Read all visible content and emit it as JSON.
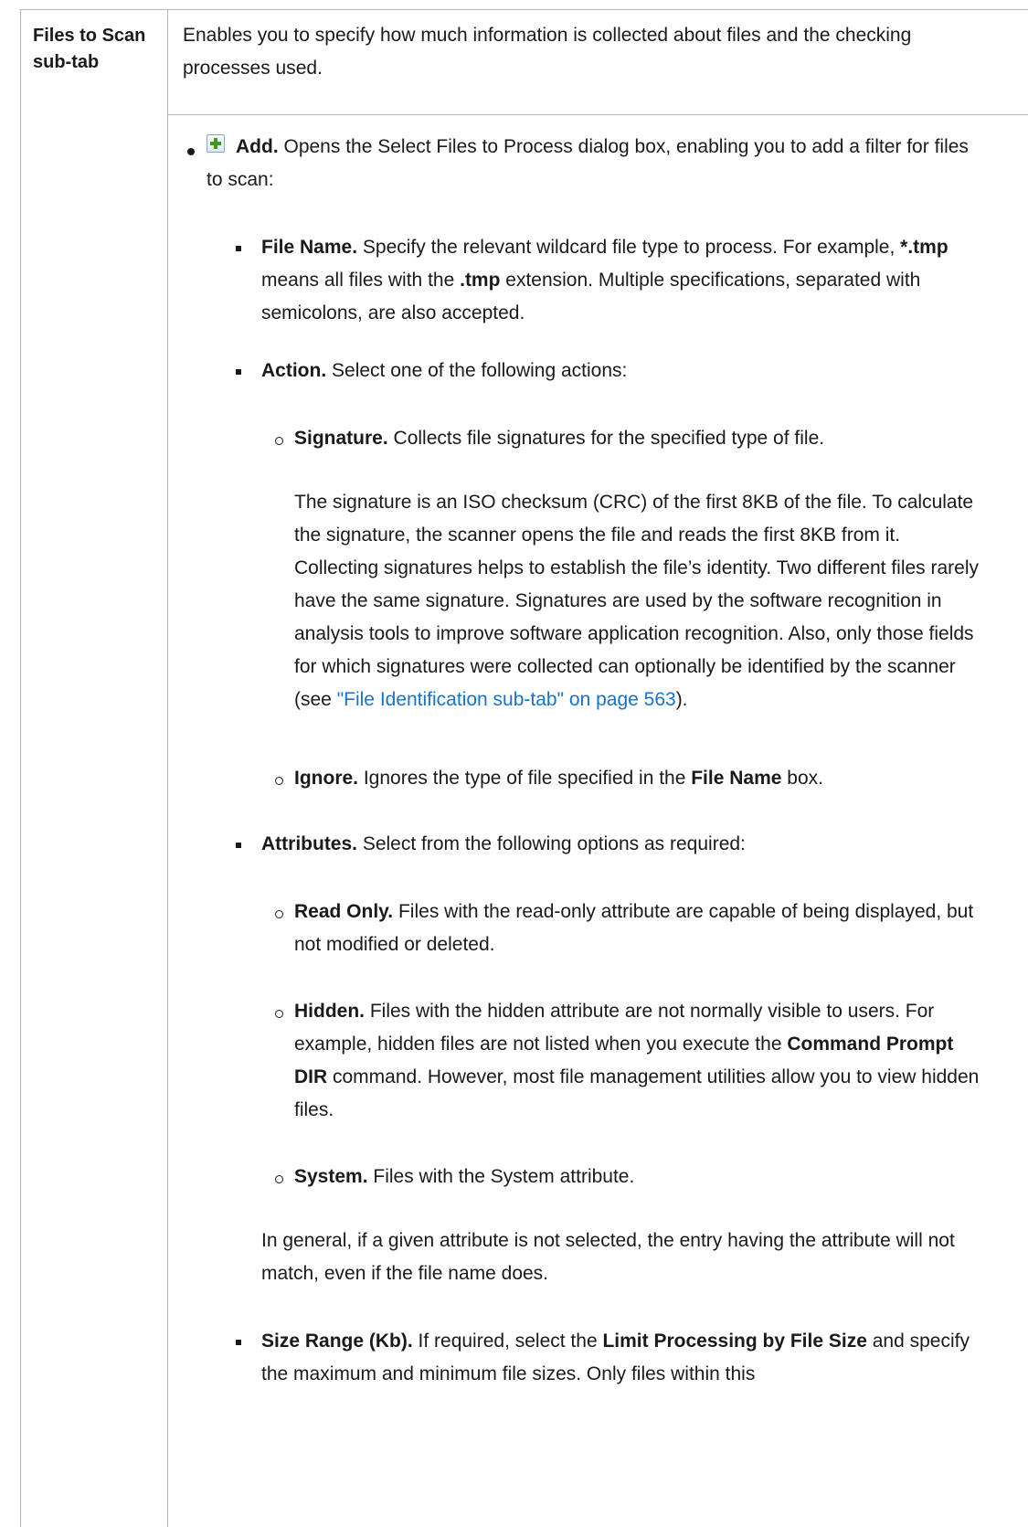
{
  "row": {
    "label": "Files to Scan\nsub-tab",
    "intro": "Enables you to specify how much information is collected about files and the checking processes used."
  },
  "add_item": {
    "icon": "add-icon",
    "label": "Add.",
    "text": " Opens the Select Files to Process dialog box, enabling you to add a filter for files to scan:"
  },
  "file_name": {
    "label": "File Name.",
    "text_a": " Specify the relevant wildcard file type to process. For example, ",
    "bold_pattern": "*.tmp",
    "text_b": " means all files with the ",
    "bold_ext": ".tmp",
    "text_c": " extension. Multiple specifications, separated with semicolons, are also accepted."
  },
  "action": {
    "label": "Action.",
    "text": " Select one of the following actions:"
  },
  "signature": {
    "label": "Signature.",
    "text": " Collects file signatures for the specified type of file.",
    "detail": "The signature is an ISO checksum (CRC) of the first 8KB of the file. To calculate the signature, the scanner opens the file and reads the first 8KB from it. Collecting signatures helps to establish the file’s identity. Two different files rarely have the same signature. Signatures are used by the software recognition in analysis tools to improve software application recognition. Also, only those fields for which signatures were collected can optionally be identified by the scanner (see ",
    "xref": "\"File Identification sub-tab\" on page 563",
    "detail_end": ")."
  },
  "ignore": {
    "label": "Ignore.",
    "text_a": " Ignores the type of file specified in the ",
    "bold": "File Name",
    "text_b": " box."
  },
  "attributes": {
    "label": "Attributes.",
    "text": " Select from the following options as required:"
  },
  "read_only": {
    "label": "Read Only.",
    "text": " Files with the read-only attribute are capable of being displayed, but not modified or deleted."
  },
  "hidden": {
    "label": "Hidden.",
    "text_a": " Files with the hidden attribute are not normally visible to users. For example, hidden files are not listed when you execute the ",
    "bold": "Command Prompt DIR",
    "text_b": " command. However, most file management utilities allow you to view hidden files."
  },
  "system": {
    "label": "System.",
    "text": " Files with the System attribute."
  },
  "general_note": "In general, if a given attribute is not selected, the entry having the attribute will not match, even if the file name does.",
  "size_range": {
    "label": "Size Range (Kb).",
    "text_a": " If required, select the ",
    "bold": "Limit Processing by File Size",
    "text_b": " and specify the maximum and minimum file sizes. Only files within this"
  }
}
